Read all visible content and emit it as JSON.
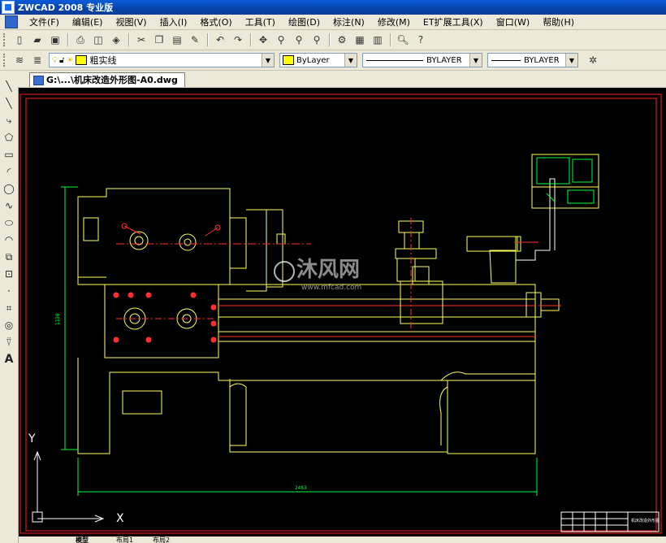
{
  "window": {
    "title": "ZWCAD 2008 专业版"
  },
  "menu": [
    "文件(F)",
    "编辑(E)",
    "视图(V)",
    "插入(I)",
    "格式(O)",
    "工具(T)",
    "绘图(D)",
    "标注(N)",
    "修改(M)",
    "ET扩展工具(X)",
    "窗口(W)",
    "帮助(H)"
  ],
  "properties": {
    "layer": "粗实线",
    "color": "ByLayer",
    "linetype": "BYLAYER",
    "lineweight": "BYLAYER"
  },
  "document": {
    "tab_label": "G:\\...\\机床改造外形图-A0.dwg"
  },
  "drawing": {
    "dimension_width": "2483",
    "dimension_height": "1330",
    "watermark_main": "沐风网",
    "watermark_url": "www.mfcad.com",
    "axis_x": "X",
    "axis_y": "Y",
    "title_block_text": "机床改造外形图"
  },
  "layout_tabs": [
    "模型",
    "布局1",
    "布局2"
  ],
  "colors": {
    "canvas": "#000000",
    "frame": "#ff2020",
    "outline": "#ffff60",
    "green": "#00ff40",
    "red_centerline": "#ff3030",
    "white": "#ffffff",
    "cyan": "#00e0ff"
  }
}
